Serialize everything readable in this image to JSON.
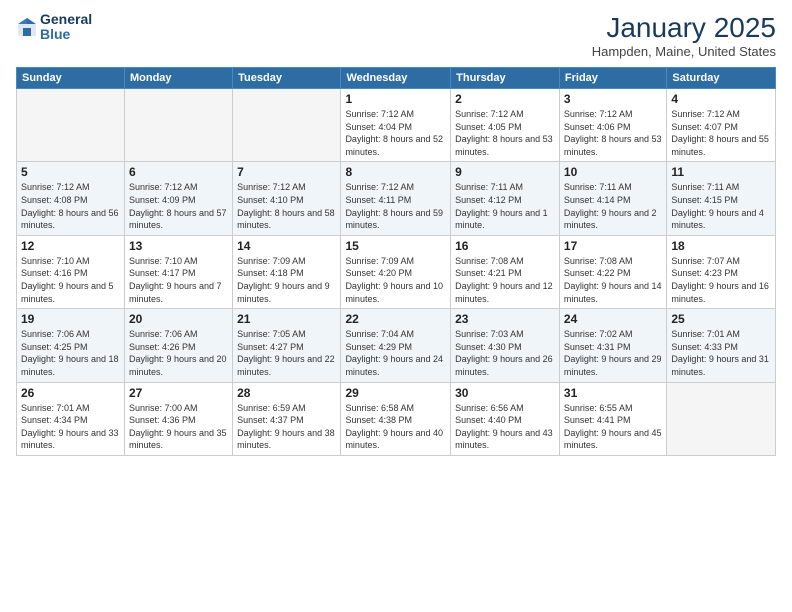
{
  "logo": {
    "line1": "General",
    "line2": "Blue"
  },
  "title": "January 2025",
  "location": "Hampden, Maine, United States",
  "weekdays": [
    "Sunday",
    "Monday",
    "Tuesday",
    "Wednesday",
    "Thursday",
    "Friday",
    "Saturday"
  ],
  "weeks": [
    [
      {
        "day": "",
        "info": ""
      },
      {
        "day": "",
        "info": ""
      },
      {
        "day": "",
        "info": ""
      },
      {
        "day": "1",
        "info": "Sunrise: 7:12 AM\nSunset: 4:04 PM\nDaylight: 8 hours and 52 minutes."
      },
      {
        "day": "2",
        "info": "Sunrise: 7:12 AM\nSunset: 4:05 PM\nDaylight: 8 hours and 53 minutes."
      },
      {
        "day": "3",
        "info": "Sunrise: 7:12 AM\nSunset: 4:06 PM\nDaylight: 8 hours and 53 minutes."
      },
      {
        "day": "4",
        "info": "Sunrise: 7:12 AM\nSunset: 4:07 PM\nDaylight: 8 hours and 55 minutes."
      }
    ],
    [
      {
        "day": "5",
        "info": "Sunrise: 7:12 AM\nSunset: 4:08 PM\nDaylight: 8 hours and 56 minutes."
      },
      {
        "day": "6",
        "info": "Sunrise: 7:12 AM\nSunset: 4:09 PM\nDaylight: 8 hours and 57 minutes."
      },
      {
        "day": "7",
        "info": "Sunrise: 7:12 AM\nSunset: 4:10 PM\nDaylight: 8 hours and 58 minutes."
      },
      {
        "day": "8",
        "info": "Sunrise: 7:12 AM\nSunset: 4:11 PM\nDaylight: 8 hours and 59 minutes."
      },
      {
        "day": "9",
        "info": "Sunrise: 7:11 AM\nSunset: 4:12 PM\nDaylight: 9 hours and 1 minute."
      },
      {
        "day": "10",
        "info": "Sunrise: 7:11 AM\nSunset: 4:14 PM\nDaylight: 9 hours and 2 minutes."
      },
      {
        "day": "11",
        "info": "Sunrise: 7:11 AM\nSunset: 4:15 PM\nDaylight: 9 hours and 4 minutes."
      }
    ],
    [
      {
        "day": "12",
        "info": "Sunrise: 7:10 AM\nSunset: 4:16 PM\nDaylight: 9 hours and 5 minutes."
      },
      {
        "day": "13",
        "info": "Sunrise: 7:10 AM\nSunset: 4:17 PM\nDaylight: 9 hours and 7 minutes."
      },
      {
        "day": "14",
        "info": "Sunrise: 7:09 AM\nSunset: 4:18 PM\nDaylight: 9 hours and 9 minutes."
      },
      {
        "day": "15",
        "info": "Sunrise: 7:09 AM\nSunset: 4:20 PM\nDaylight: 9 hours and 10 minutes."
      },
      {
        "day": "16",
        "info": "Sunrise: 7:08 AM\nSunset: 4:21 PM\nDaylight: 9 hours and 12 minutes."
      },
      {
        "day": "17",
        "info": "Sunrise: 7:08 AM\nSunset: 4:22 PM\nDaylight: 9 hours and 14 minutes."
      },
      {
        "day": "18",
        "info": "Sunrise: 7:07 AM\nSunset: 4:23 PM\nDaylight: 9 hours and 16 minutes."
      }
    ],
    [
      {
        "day": "19",
        "info": "Sunrise: 7:06 AM\nSunset: 4:25 PM\nDaylight: 9 hours and 18 minutes."
      },
      {
        "day": "20",
        "info": "Sunrise: 7:06 AM\nSunset: 4:26 PM\nDaylight: 9 hours and 20 minutes."
      },
      {
        "day": "21",
        "info": "Sunrise: 7:05 AM\nSunset: 4:27 PM\nDaylight: 9 hours and 22 minutes."
      },
      {
        "day": "22",
        "info": "Sunrise: 7:04 AM\nSunset: 4:29 PM\nDaylight: 9 hours and 24 minutes."
      },
      {
        "day": "23",
        "info": "Sunrise: 7:03 AM\nSunset: 4:30 PM\nDaylight: 9 hours and 26 minutes."
      },
      {
        "day": "24",
        "info": "Sunrise: 7:02 AM\nSunset: 4:31 PM\nDaylight: 9 hours and 29 minutes."
      },
      {
        "day": "25",
        "info": "Sunrise: 7:01 AM\nSunset: 4:33 PM\nDaylight: 9 hours and 31 minutes."
      }
    ],
    [
      {
        "day": "26",
        "info": "Sunrise: 7:01 AM\nSunset: 4:34 PM\nDaylight: 9 hours and 33 minutes."
      },
      {
        "day": "27",
        "info": "Sunrise: 7:00 AM\nSunset: 4:36 PM\nDaylight: 9 hours and 35 minutes."
      },
      {
        "day": "28",
        "info": "Sunrise: 6:59 AM\nSunset: 4:37 PM\nDaylight: 9 hours and 38 minutes."
      },
      {
        "day": "29",
        "info": "Sunrise: 6:58 AM\nSunset: 4:38 PM\nDaylight: 9 hours and 40 minutes."
      },
      {
        "day": "30",
        "info": "Sunrise: 6:56 AM\nSunset: 4:40 PM\nDaylight: 9 hours and 43 minutes."
      },
      {
        "day": "31",
        "info": "Sunrise: 6:55 AM\nSunset: 4:41 PM\nDaylight: 9 hours and 45 minutes."
      },
      {
        "day": "",
        "info": ""
      }
    ]
  ]
}
